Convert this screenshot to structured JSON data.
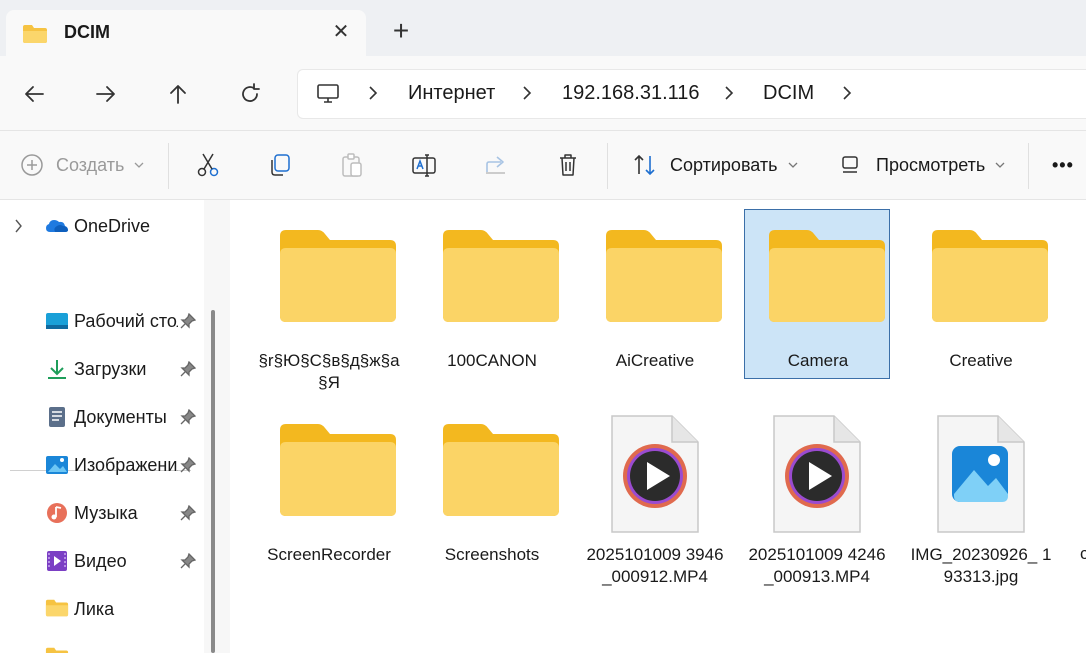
{
  "tab": {
    "title": "DCIM",
    "close": "✕",
    "new": "+"
  },
  "breadcrumbs": [
    "Интернет",
    "192.168.31.116",
    "DCIM"
  ],
  "toolbar": {
    "create_label": "Создать",
    "sort_label": "Сортировать",
    "view_label": "Просмотреть",
    "more_label": "•••"
  },
  "sidebar": {
    "onedrive": "OneDrive",
    "items": [
      {
        "label": "Рабочий стол",
        "icon": "desktop-icon",
        "pinned": true
      },
      {
        "label": "Загрузки",
        "icon": "downloads-icon",
        "pinned": true
      },
      {
        "label": "Документы",
        "icon": "documents-icon",
        "pinned": true
      },
      {
        "label": "Изображения",
        "icon": "pictures-icon",
        "pinned": true
      },
      {
        "label": "Музыка",
        "icon": "music-icon",
        "pinned": true
      },
      {
        "label": "Видео",
        "icon": "videos-icon",
        "pinned": true
      },
      {
        "label": "Лика",
        "icon": "folder-icon",
        "pinned": false
      }
    ]
  },
  "files": [
    {
      "name": "§r§Ю§C§в§д§ж§а§Я",
      "type": "folder",
      "selected": false
    },
    {
      "name": "100CANON",
      "type": "folder",
      "selected": false
    },
    {
      "name": "AiCreative",
      "type": "folder",
      "selected": false
    },
    {
      "name": "Camera",
      "type": "folder",
      "selected": true
    },
    {
      "name": "Creative",
      "type": "folder",
      "selected": false
    },
    {
      "name": "ScreenRecorder",
      "type": "folder",
      "selected": false
    },
    {
      "name": "Screenshots",
      "type": "folder",
      "selected": false
    },
    {
      "name": "2025101009 3946_000912.MP4",
      "type": "video",
      "selected": false
    },
    {
      "name": "2025101009 4246_000913.MP4",
      "type": "video",
      "selected": false
    },
    {
      "name": "IMG_20230926_ 193313.jpg",
      "type": "image",
      "selected": false
    }
  ],
  "colors": {
    "selected_bg": "#cce4f7",
    "selected_border": "#3b6fa8",
    "folder": "#f6c342"
  }
}
